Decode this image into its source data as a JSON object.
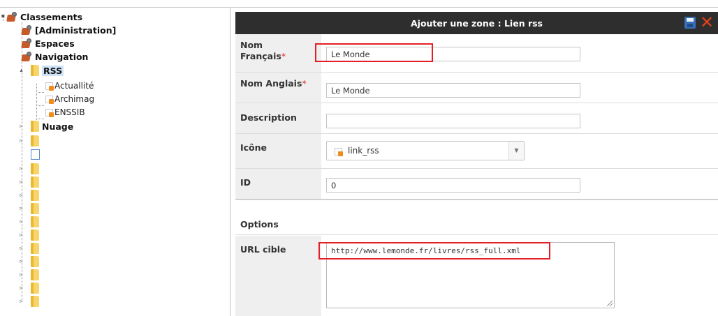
{
  "tree": {
    "root": "Classements",
    "items": [
      {
        "label": "[Administration]"
      },
      {
        "label": "Espaces"
      },
      {
        "label": "Navigation"
      },
      {
        "label": "RSS"
      },
      {
        "label": "Actuallité"
      },
      {
        "label": "Archimag"
      },
      {
        "label": "ENSSIB"
      },
      {
        "label": "Nuage"
      }
    ]
  },
  "form": {
    "title": "Ajouter une zone : Lien rss",
    "fields": {
      "nom_francais": {
        "label_line1": "Nom",
        "label_line2": "Français",
        "required": "*",
        "value": "Le Monde"
      },
      "nom_anglais": {
        "label": "Nom Anglais",
        "required": "*",
        "value": "Le Monde"
      },
      "description": {
        "label": "Description",
        "value": ""
      },
      "icone": {
        "label": "Icône",
        "value": "link_rss"
      },
      "id": {
        "label": "ID",
        "value": "0"
      }
    },
    "options_label": "Options",
    "url_cible": {
      "label": "URL cible",
      "value": "http://www.lemonde.fr/livres/rss_full.xml"
    }
  },
  "colors": {
    "header_bg": "#2e2e2e",
    "highlight": "#e21f26",
    "required": "#e0291f"
  }
}
